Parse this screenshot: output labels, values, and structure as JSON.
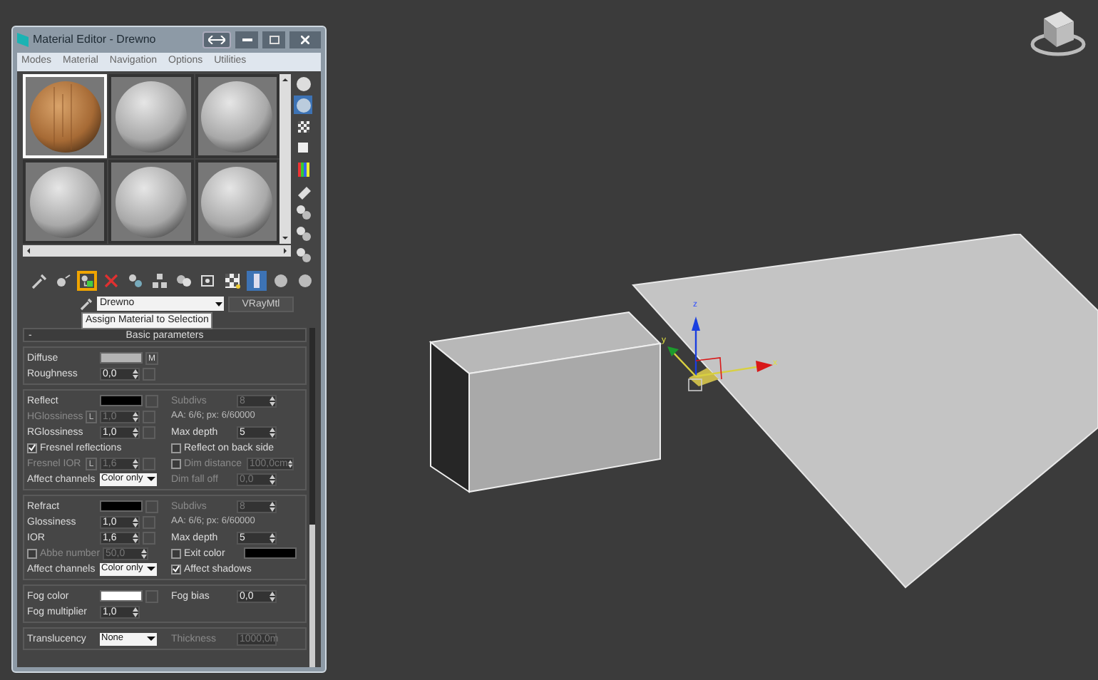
{
  "window": {
    "title": "Material Editor - Drewno"
  },
  "menu": [
    "Modes",
    "Material",
    "Navigation",
    "Options",
    "Utilities"
  ],
  "slots": [
    {
      "kind": "wood",
      "selected": true
    },
    {
      "kind": "plain",
      "selected": false
    },
    {
      "kind": "plain",
      "selected": false
    },
    {
      "kind": "plain",
      "selected": false
    },
    {
      "kind": "plain",
      "selected": false
    },
    {
      "kind": "plain",
      "selected": false
    }
  ],
  "side_tools": [
    {
      "kind": "sphere",
      "highlighted": false
    },
    {
      "kind": "backlight",
      "highlighted": true
    },
    {
      "kind": "checker",
      "highlighted": false
    },
    {
      "kind": "square",
      "highlighted": false
    },
    {
      "kind": "colorbars",
      "highlighted": false
    },
    {
      "kind": "eraser",
      "highlighted": false
    },
    {
      "kind": "spheres",
      "highlighted": false
    },
    {
      "kind": "spheres",
      "highlighted": false
    },
    {
      "kind": "spheres",
      "highlighted": false
    }
  ],
  "toolbar": [
    {
      "kind": "pick",
      "highlighted": false
    },
    {
      "kind": "put",
      "highlighted": false
    },
    {
      "kind": "assign",
      "highlighted": true
    },
    {
      "kind": "delete",
      "highlighted": false
    },
    {
      "kind": "copy",
      "highlighted": false
    },
    {
      "kind": "unique",
      "highlighted": false
    },
    {
      "kind": "effects",
      "highlighted": false
    },
    {
      "kind": "map",
      "highlighted": false
    },
    {
      "kind": "checker",
      "highlighted": false
    },
    {
      "kind": "bar",
      "highlighted": true
    },
    {
      "kind": "spheres",
      "highlighted": false
    },
    {
      "kind": "spheres",
      "highlighted": false
    }
  ],
  "tooltip": "Assign Material to Selection",
  "material_name": "Drewno",
  "material_type": "VRayMtl",
  "rollout": {
    "toggle": "-",
    "title": "Basic parameters",
    "sections": [
      [
        {
          "left": {
            "kind": "swatch",
            "label": "Diffuse",
            "color": "#b4b4b4",
            "map": "M"
          }
        },
        {
          "left": {
            "kind": "spinner",
            "label": "Roughness",
            "value": "0,0",
            "map": true,
            "disabled": false
          }
        }
      ],
      [
        {
          "left": {
            "kind": "swatch",
            "label": "Reflect",
            "color": "#000000"
          },
          "right": {
            "kind": "spinner",
            "label": "Subdivs",
            "value": "8",
            "disabled": true
          }
        },
        {
          "left": {
            "kind": "spinner",
            "label": "HGlossiness",
            "lock": "L",
            "value": "1,0",
            "map": true,
            "disabled": true
          },
          "right": {
            "kind": "readout",
            "text": "AA: 6/6; px: 6/60000"
          }
        },
        {
          "left": {
            "kind": "spinner",
            "label": "RGlossiness",
            "value": "1,0",
            "map": true,
            "disabled": false
          },
          "right": {
            "kind": "spinner",
            "label": "Max depth",
            "value": "5",
            "disabled": false
          }
        },
        {
          "left": {
            "kind": "check",
            "label": "Fresnel reflections",
            "checked": true
          },
          "right": {
            "kind": "check",
            "label": "Reflect on back side",
            "checked": false
          }
        },
        {
          "left": {
            "kind": "spinner",
            "label": "Fresnel IOR",
            "lock": "L",
            "value": "1,6",
            "map": true,
            "disabled": true
          },
          "right": {
            "kind": "check_spinner",
            "label": "Dim distance",
            "checked": false,
            "value": "100,0cm",
            "disabled": true
          }
        },
        {
          "left": {
            "kind": "dropdown",
            "label": "Affect channels",
            "value": "Color only"
          },
          "right": {
            "kind": "spinner",
            "label": "Dim fall off",
            "value": "0,0",
            "disabled": true
          }
        }
      ],
      [
        {
          "left": {
            "kind": "swatch",
            "label": "Refract",
            "color": "#000000"
          },
          "right": {
            "kind": "spinner",
            "label": "Subdivs",
            "value": "8",
            "disabled": true
          }
        },
        {
          "left": {
            "kind": "spinner",
            "label": "Glossiness",
            "value": "1,0",
            "map": true,
            "disabled": false
          },
          "right": {
            "kind": "readout",
            "text": "AA: 6/6; px: 6/60000"
          }
        },
        {
          "left": {
            "kind": "spinner",
            "label": "IOR",
            "value": "1,6",
            "map": true,
            "disabled": false
          },
          "right": {
            "kind": "spinner",
            "label": "Max depth",
            "value": "5",
            "disabled": false
          }
        },
        {
          "left": {
            "kind": "check_spinner",
            "label": "Abbe number",
            "checked": false,
            "value": "50,0",
            "disabled": true
          },
          "right": {
            "kind": "check_swatch",
            "label": "Exit color",
            "checked": false,
            "color": "#000000"
          }
        },
        {
          "left": {
            "kind": "dropdown",
            "label": "Affect channels",
            "value": "Color only"
          },
          "right": {
            "kind": "check",
            "label": "Affect shadows",
            "checked": true
          }
        }
      ],
      [
        {
          "left": {
            "kind": "swatch",
            "label": "Fog color",
            "color": "#ffffff"
          },
          "right": {
            "kind": "spinner",
            "label": "Fog bias",
            "value": "0,0",
            "disabled": false
          }
        },
        {
          "left": {
            "kind": "spinner",
            "label": "Fog multiplier",
            "value": "1,0",
            "disabled": false
          }
        }
      ],
      [
        {
          "left": {
            "kind": "dropdown",
            "label": "Translucency",
            "value": "None"
          },
          "right": {
            "kind": "spinner",
            "label": "Thickness",
            "value": "1000,0m",
            "disabled": true
          }
        }
      ]
    ]
  },
  "gizmo": {
    "axes": [
      "z",
      "y",
      "x"
    ]
  }
}
